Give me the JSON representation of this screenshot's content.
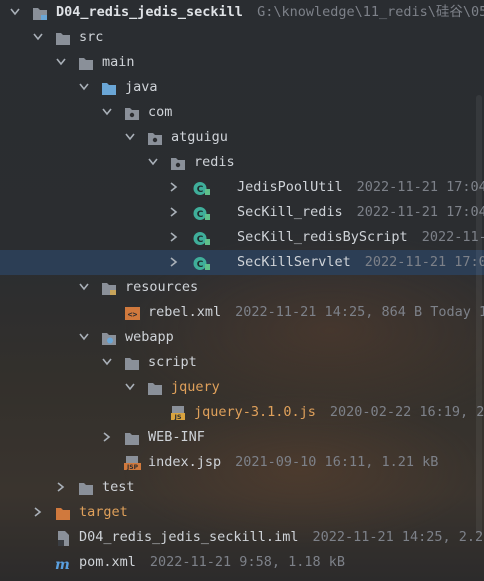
{
  "tree": {
    "project_name": "D04_redis_jedis_seckill",
    "project_path": "G:\\knowledge\\11_redis\\硅谷\\05.",
    "src": "src",
    "main": "main",
    "java": "java",
    "com": "com",
    "atguigu": "atguigu",
    "redis": "redis",
    "classes": [
      {
        "name": "JedisPoolUtil",
        "meta": "2022-11-21 17:04"
      },
      {
        "name": "SecKill_redis",
        "meta": "2022-11-21 17:04"
      },
      {
        "name": "SecKill_redisByScript",
        "meta": "2022-11-"
      },
      {
        "name": "SecKillServlet",
        "meta": "2022-11-21 17:0"
      }
    ],
    "resources": "resources",
    "rebel_xml": {
      "name": "rebel.xml",
      "meta": "2022-11-21 14:25, 864 B Today 1"
    },
    "webapp": "webapp",
    "script": "script",
    "jquery": "jquery",
    "jquery_js": {
      "name": "jquery-3.1.0.js",
      "meta": "2020-02-22 16:19, 2"
    },
    "web_inf": "WEB-INF",
    "index_jsp": {
      "name": "index.jsp",
      "meta": "2021-09-10 16:11, 1.21 kB"
    },
    "test": "test",
    "target": "target",
    "iml": {
      "name": "D04_redis_jedis_seckill.iml",
      "meta": "2022-11-21 14:25, 2.2"
    },
    "pom": {
      "name": "pom.xml",
      "meta": "2022-11-21 9:58, 1.18 kB"
    }
  },
  "colors": {
    "folder": "#8a9099",
    "source_folder": "#6aa6d6",
    "resource_folder": "#c7a35a",
    "target_folder": "#d0793d",
    "class_icon": "#3fae9a",
    "selection": "#2c3e55"
  }
}
